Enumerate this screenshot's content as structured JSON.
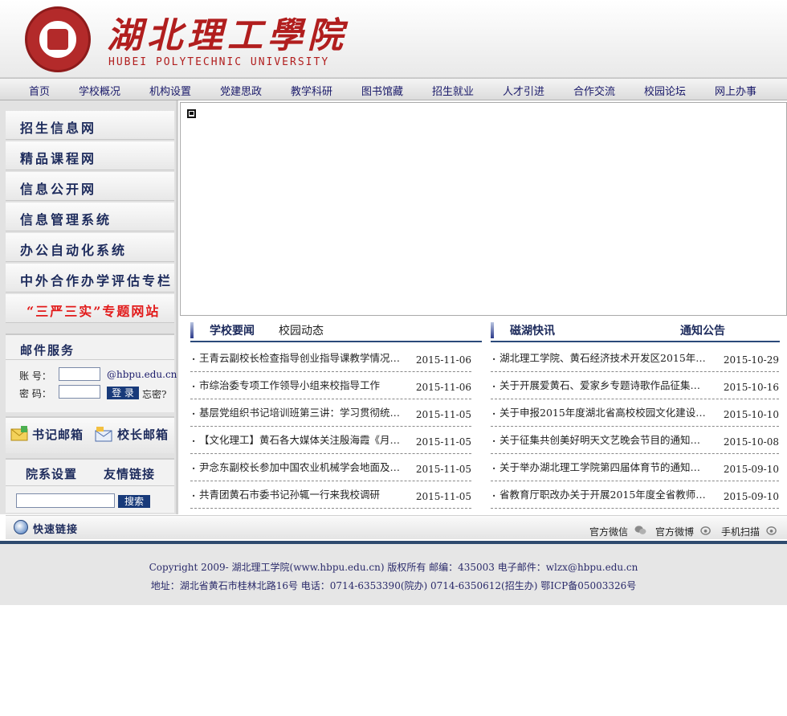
{
  "header": {
    "title": "湖北理工學院",
    "subtitle": "HUBEI POLYTECHNIC UNIVERSITY"
  },
  "nav": [
    "首页",
    "学校概况",
    "机构设置",
    "党建思政",
    "教学科研",
    "图书馆藏",
    "招生就业",
    "人才引进",
    "合作交流",
    "校园论坛",
    "网上办事"
  ],
  "sidebar": {
    "items": [
      "招生信息网",
      "精品课程网",
      "信息公开网",
      "信息管理系统",
      "办公自动化系统",
      "中外合作办学评估专栏",
      "“三严三实”专题网站"
    ],
    "mail": {
      "title": "邮件服务",
      "account_label": "账 号：",
      "password_label": "密 码：",
      "domain": "@hbpu.edu.cn",
      "login": "登 录",
      "forgot": "忘密?"
    },
    "mailboxes": {
      "secretary": "书记邮箱",
      "president": "校长邮箱"
    },
    "links": {
      "departments": "院系设置",
      "friends": "友情链接",
      "search_button": "搜索"
    }
  },
  "news_left": {
    "tab_active": "学校要闻",
    "tab_inactive": "校园动态",
    "items": [
      {
        "title": "王青云副校长检查指导创业指导课教学情况…",
        "date": "2015-11-06"
      },
      {
        "title": "市综治委专项工作领导小组来校指导工作",
        "date": "2015-11-06"
      },
      {
        "title": "基层党组织书记培训班第三讲：学习贯彻统…",
        "date": "2015-11-05"
      },
      {
        "title": "【文化理工】黄石各大媒体关注殷海霞《月…",
        "date": "2015-11-05"
      },
      {
        "title": "尹念东副校长参加中国农业机械学会地面及…",
        "date": "2015-11-05"
      },
      {
        "title": "共青团黄石市委书记孙辄一行来我校调研",
        "date": "2015-11-05"
      }
    ]
  },
  "news_right": {
    "tab_active": "磁湖快讯",
    "tab_inactive": "通知公告",
    "items": [
      {
        "title": "湖北理工学院、黄石经济技术开发区2015年…",
        "date": "2015-10-29"
      },
      {
        "title": "关于开展爱黄石、爱家乡专题诗歌作品征集…",
        "date": "2015-10-16"
      },
      {
        "title": "关于申报2015年度湖北省高校校园文化建设…",
        "date": "2015-10-10"
      },
      {
        "title": "关于征集共创美好明天文艺晚会节目的通知…",
        "date": "2015-10-08"
      },
      {
        "title": "关于举办湖北理工学院第四届体育节的通知…",
        "date": "2015-09-10"
      },
      {
        "title": "省教育厅职改办关于开展2015年度全省教师…",
        "date": "2015-09-10"
      }
    ]
  },
  "quick": {
    "title": "快速链接",
    "wechat": "官方微信",
    "weibo": "官方微博",
    "scan": "手机扫描"
  },
  "footer": {
    "line1": "Copyright 2009- 湖北理工学院(www.hbpu.edu.cn) 版权所有  邮编：435003 电子邮件：wlzx@hbpu.edu.cn",
    "line2": "地址：湖北省黄石市桂林北路16号  电话：0714-6353390(院办) 0714-6350612(招生办) 鄂ICP备05003326号"
  }
}
